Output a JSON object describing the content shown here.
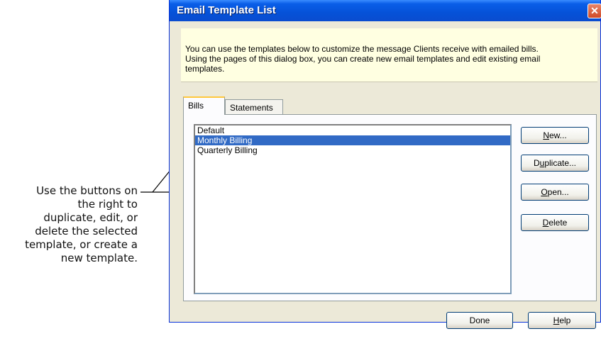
{
  "callout": {
    "lines": [
      "Use the buttons on",
      "the right to",
      "duplicate, edit, or",
      "delete the selected",
      "template, or create a",
      "new template."
    ]
  },
  "dialog": {
    "title": "Email Template List",
    "close_glyph": "✕",
    "info_lines": [
      "You can use the templates below to customize the message Clients receive with emailed bills.",
      "Using the pages of this dialog box, you can create new email templates and edit existing email",
      "templates."
    ],
    "tabs": [
      {
        "label": "Bills",
        "active": true
      },
      {
        "label": "Statements",
        "active": false
      }
    ],
    "templates": [
      "Default",
      "Monthly Billing",
      "Quarterly Billing"
    ],
    "selected_template": "Monthly Billing",
    "side_buttons": {
      "new": {
        "mnemonic": "N",
        "rest": "ew..."
      },
      "duplicate": {
        "pre": "D",
        "mnemonic": "u",
        "rest": "plicate..."
      },
      "open": {
        "mnemonic": "O",
        "rest": "pen..."
      },
      "delete": {
        "mnemonic": "D",
        "rest": "elete"
      }
    },
    "footer_buttons": {
      "done": "Done",
      "help": {
        "mnemonic": "H",
        "rest": "elp"
      }
    }
  }
}
